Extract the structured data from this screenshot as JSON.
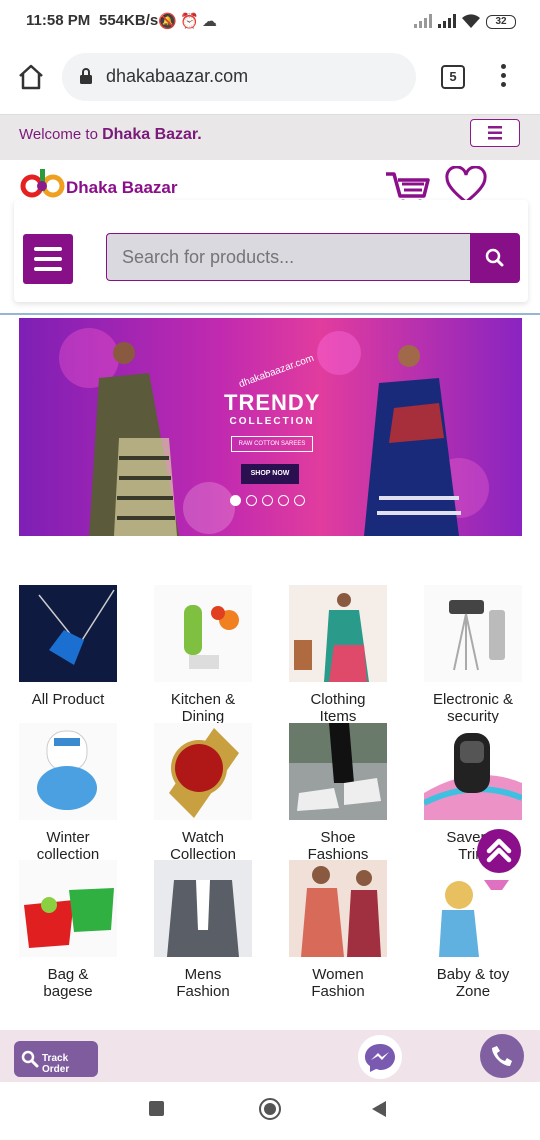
{
  "status": {
    "time": "11:58 PM",
    "speed": "554KB/s",
    "battery": "32"
  },
  "browser": {
    "url": "dhakabaazar.com",
    "tab_count": "5"
  },
  "welcome": {
    "prefix": "Welcome to ",
    "site": "Dhaka Bazar."
  },
  "header": {
    "logo_text": "Dhaka Baazar"
  },
  "search": {
    "placeholder": "Search for products..."
  },
  "banner": {
    "watermark": "dhakabaazar.com",
    "title": "TRENDY",
    "subtitle": "COLLECTION",
    "tag": "RAW COTTON SAREES",
    "cta": "SHOP NOW",
    "slides": 5,
    "active_slide": 1
  },
  "categories": [
    {
      "label_1": "All Product",
      "label_2": ""
    },
    {
      "label_1": "Kitchen &",
      "label_2": "Dining"
    },
    {
      "label_1": "Clothing",
      "label_2": "Items"
    },
    {
      "label_1": "Electronic &",
      "label_2": "security"
    },
    {
      "label_1": "Winter",
      "label_2": "collection"
    },
    {
      "label_1": "Watch",
      "label_2": "Collection"
    },
    {
      "label_1": "Shoe",
      "label_2": "Fashions"
    },
    {
      "label_1": "Saver &",
      "label_2": "Trim"
    },
    {
      "label_1": "Bag &",
      "label_2": "bagese"
    },
    {
      "label_1": "Mens",
      "label_2": "Fashion"
    },
    {
      "label_1": "Women",
      "label_2": "Fashion"
    },
    {
      "label_1": "Baby & toy",
      "label_2": "Zone"
    }
  ],
  "bottom": {
    "track_label": "Track Order"
  },
  "colors": {
    "brand": "#870f87",
    "banner_pink": "#e13c9e"
  }
}
